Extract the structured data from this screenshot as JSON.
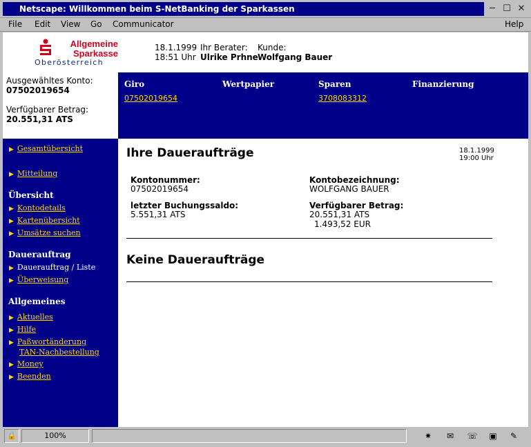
{
  "window": {
    "title": "Netscape: Willkommen beim S-NetBanking der Sparkassen",
    "minimize": "─",
    "maximize": "☐",
    "close": "✕"
  },
  "menu": [
    "File",
    "Edit",
    "View",
    "Go",
    "Communicator",
    "Help"
  ],
  "logo": {
    "line1": "Allgemeine",
    "line2": "Sparkasse",
    "line3": "Oberösterreich"
  },
  "header": {
    "date": "18.1.1999",
    "time": "18:51 Uhr",
    "advisor_label": "Ihr Berater:",
    "advisor_name": "Ulrike Prhne",
    "customer_label": "Kunde:",
    "customer_name": "Wolfgang Bauer"
  },
  "account_box": {
    "selected_label": "Ausgewähltes Konto:",
    "selected_value": "07502019654",
    "available_label": "Verfügbarer Betrag:",
    "available_value": "20.551,31 ATS"
  },
  "topnav": {
    "tabs": [
      "Giro",
      "Wertpapier",
      "Sparen",
      "Finanzierung"
    ],
    "giro_link": "07502019654",
    "sparen_link": "3708083312"
  },
  "sidebar": {
    "gesamt": "Gesamtübersicht",
    "mitteilung": "Mitteilung",
    "sect_uebersicht": "Übersicht",
    "kontodetails": "Kontodetails",
    "kartenuebersicht": "Kartenübersicht",
    "umsaetze": "Umsätze suchen",
    "sect_dauerauftrag": "Dauerauftrag",
    "dauerauftrag_liste": "Dauerauftrag / Liste",
    "ueberweisung": "Überweisung",
    "sect_allgemeines": "Allgemeines",
    "aktuelles": "Aktuelles",
    "hilfe": "Hilfe",
    "passwort1": "Paßwortänderung",
    "passwort2": "TAN-Nachbestellung",
    "money": "Money",
    "beenden": "Beenden"
  },
  "content": {
    "title": "Ihre Daueraufträge",
    "date": "18.1.1999",
    "time": "19:00 Uhr",
    "kontonummer_label": "Kontonummer:",
    "kontonummer_value": "07502019654",
    "bezeichnung_label": "Kontobezeichnung:",
    "bezeichnung_value": "WOLFGANG BAUER",
    "saldo_label": "letzter Buchungssaldo:",
    "saldo_value": "5.551,31 ATS",
    "verfuegbar_label": "Verfügbarer Betrag:",
    "verfuegbar_ats": "20.551,31 ATS",
    "verfuegbar_eur": "1.493,52 EUR",
    "empty_message": "Keine Daueraufträge"
  },
  "statusbar": {
    "zoom": "100%"
  },
  "colors": {
    "nav_blue": "#000088",
    "link_yellow": "#ffd700",
    "brand_red": "#d4001a"
  }
}
